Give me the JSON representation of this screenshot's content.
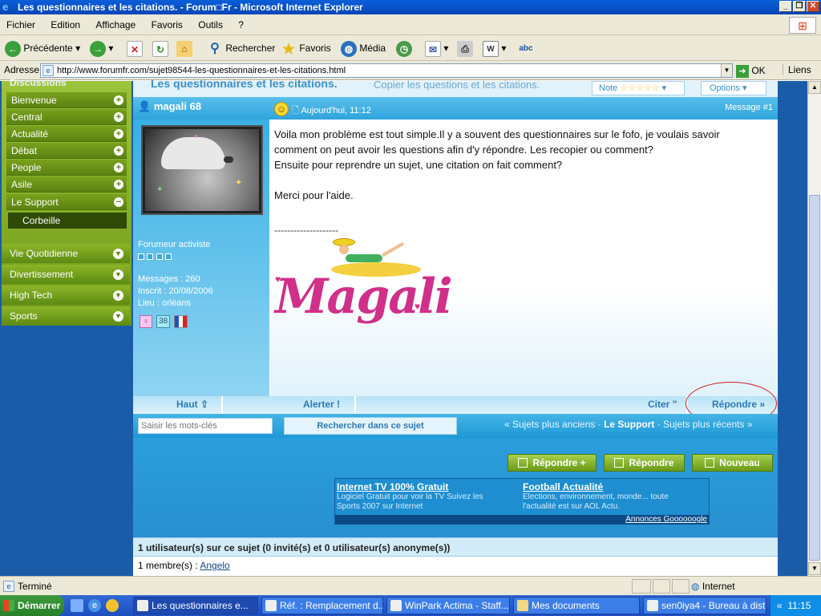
{
  "window": {
    "title": "Les questionnaires et les citations. - Forum□Fr - Microsoft Internet Explorer"
  },
  "menu": [
    "Fichier",
    "Edition",
    "Affichage",
    "Favoris",
    "Outils",
    "?"
  ],
  "toolbar": {
    "back": "Précédente",
    "search": "Rechercher",
    "favorites": "Favoris",
    "media": "Média"
  },
  "address": {
    "label": "Adresse",
    "url": "http://www.forumfr.com/sujet98544-les-questionnaires-et-les-citations.html",
    "go": "OK",
    "links": "Liens"
  },
  "sidebar": {
    "partial_header": "Discussions",
    "items": [
      {
        "label": "Bienvenue",
        "sign": "+"
      },
      {
        "label": "Central",
        "sign": "+"
      },
      {
        "label": "Actualité",
        "sign": "+"
      },
      {
        "label": "Débat",
        "sign": "+"
      },
      {
        "label": "People",
        "sign": "+"
      },
      {
        "label": "Asile",
        "sign": "+"
      },
      {
        "label": "Le Support",
        "sign": "−"
      }
    ],
    "sub_item": "Corbeille",
    "groups": [
      "Vie Quotidienne",
      "Divertissement",
      "High Tech",
      "Sports"
    ]
  },
  "topic": {
    "title": "Les questionnaires et les citations.",
    "subtitle": "Copier les questions et les citations.",
    "note_label": "Note",
    "options_label": "Options"
  },
  "post": {
    "author": "magali 68",
    "date": "Aujourd'hui, 11:12",
    "message_number": "Message #1",
    "rank": "Forumeur activiste",
    "messages": "Messages : 260",
    "inscrit": "Inscrit : 20/08/2006",
    "lieu": "Lieu : orléans",
    "age_badge": "38",
    "body": [
      "Voila mon problème est tout simple.Il y a souvent des questionnaires sur le fofo, je voulais savoir",
      "comment on peut avoir les questions afin d'y répondre. Les recopier ou comment?",
      "Ensuite pour reprendre un sujet, une citation on fait comment?",
      "",
      "Merci pour l'aide."
    ],
    "separator": "--------------------",
    "signature": "Magali"
  },
  "actions": {
    "top": "Haut",
    "alert": "Alerter",
    "quote": "Citer",
    "reply": "Répondre"
  },
  "search": {
    "placeholder": "Saisir les mots-clés",
    "button": "Rechercher dans ce sujet"
  },
  "nav": {
    "older": "« Sujets plus anciens",
    "sep1": "·",
    "current": "Le Support",
    "sep2": "·",
    "newer": "Sujets plus récents »"
  },
  "buttons": {
    "reply_plus": "Répondre +",
    "reply": "Répondre",
    "new": "Nouveau"
  },
  "ads": [
    {
      "title": "Internet TV 100% Gratuit",
      "line1": "Logiciel Gratuit pour voir la TV Suivez les",
      "line2": "Sports 2007 sur Internet"
    },
    {
      "title": "Football Actualité",
      "line1": "Elections, environnement, monde... toute",
      "line2": "l'actualité est sur AOL Actu."
    }
  ],
  "ads_footer": "Annonces Goooooogle",
  "users_bar": "1 utilisateur(s) sur ce sujet (0 invité(s) et 0 utilisateur(s) anonyme(s))",
  "membres": {
    "label": "1 membre(s) : ",
    "name": "Angelo"
  },
  "statusbar": {
    "text": "Terminé",
    "zone": "Internet"
  },
  "taskbar": {
    "start": "Démarrer",
    "tasks": [
      "Les questionnaires e...",
      "Réf. : Remplacement d...",
      "WinPark Actima - Staff...",
      "Mes documents",
      "sen0iya4 - Bureau à dist..."
    ],
    "clock": "11:15"
  }
}
